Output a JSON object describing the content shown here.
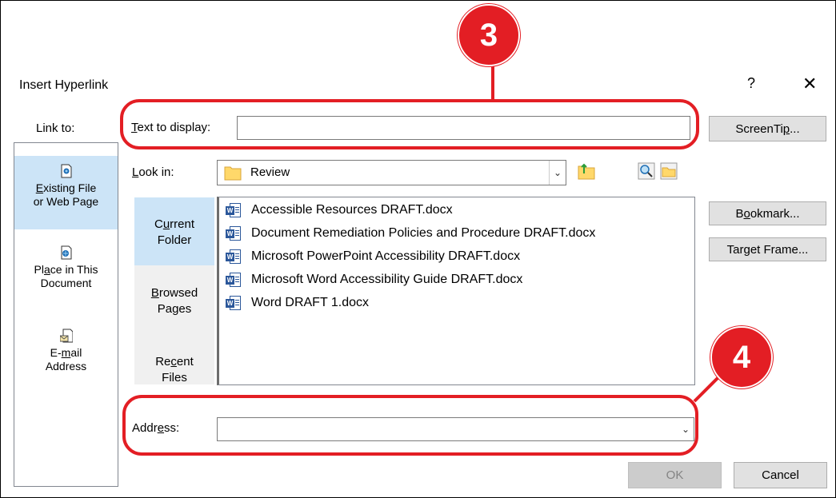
{
  "dialog": {
    "title": "Insert Hyperlink",
    "help_label": "?",
    "close_label": "✕"
  },
  "link_to": {
    "heading": "Link to:",
    "items": [
      {
        "line1_pre": "",
        "line1_u": "E",
        "line1_post": "xisting File",
        "line2": "or Web Page",
        "icon": "existing-file-icon",
        "selected": true
      },
      {
        "line1_pre": "Pl",
        "line1_u": "a",
        "line1_post": "ce in This",
        "line2": "Document",
        "icon": "place-in-document-icon",
        "selected": false
      },
      {
        "line1_pre": "E-",
        "line1_u": "m",
        "line1_post": "ail",
        "line2": "Address",
        "icon": "email-address-icon",
        "selected": false
      }
    ]
  },
  "text_to_display": {
    "label_u": "T",
    "label_rest": "ext to display:",
    "value": ""
  },
  "screentip": {
    "label_pre": "ScreenTi",
    "label_u": "p",
    "label_post": "..."
  },
  "look_in": {
    "label_u": "L",
    "label_rest": "ook in:",
    "value": "Review",
    "folder_icon": "folder-icon"
  },
  "toolbar_icons": [
    "up-folder-icon",
    "browse-web-icon",
    "browse-file-icon"
  ],
  "subnav": [
    {
      "line1_pre": "C",
      "line1_u": "u",
      "line1_post": "rrent",
      "line2": "Folder",
      "selected": true
    },
    {
      "line1_pre": "",
      "line1_u": "B",
      "line1_post": "rowsed",
      "line2": "Pages",
      "selected": false
    },
    {
      "line1_pre": "Re",
      "line1_u": "c",
      "line1_post": "ent",
      "line2": "Files",
      "selected": false
    }
  ],
  "files": [
    "Accessible Resources DRAFT.docx",
    "Document Remediation Policies and Procedure DRAFT.docx",
    "Microsoft PowerPoint Accessibility DRAFT.docx",
    "Microsoft Word Accessibility Guide DRAFT.docx",
    "Word DRAFT 1.docx"
  ],
  "bookmark": {
    "label_pre": "B",
    "label_u": "o",
    "label_post": "okmark..."
  },
  "target_frame": {
    "label_pre": "Tar",
    "label_u": "g",
    "label_post": "et Frame..."
  },
  "address": {
    "label_pre": "Addr",
    "label_u": "e",
    "label_post": "ss:",
    "value": ""
  },
  "buttons": {
    "ok": "OK",
    "cancel": "Cancel"
  },
  "callouts": {
    "badge_3": "3",
    "badge_4": "4"
  },
  "colors": {
    "callout_red": "#e31e24",
    "selection_blue": "#cce4f7",
    "word_blue": "#2b579a"
  }
}
